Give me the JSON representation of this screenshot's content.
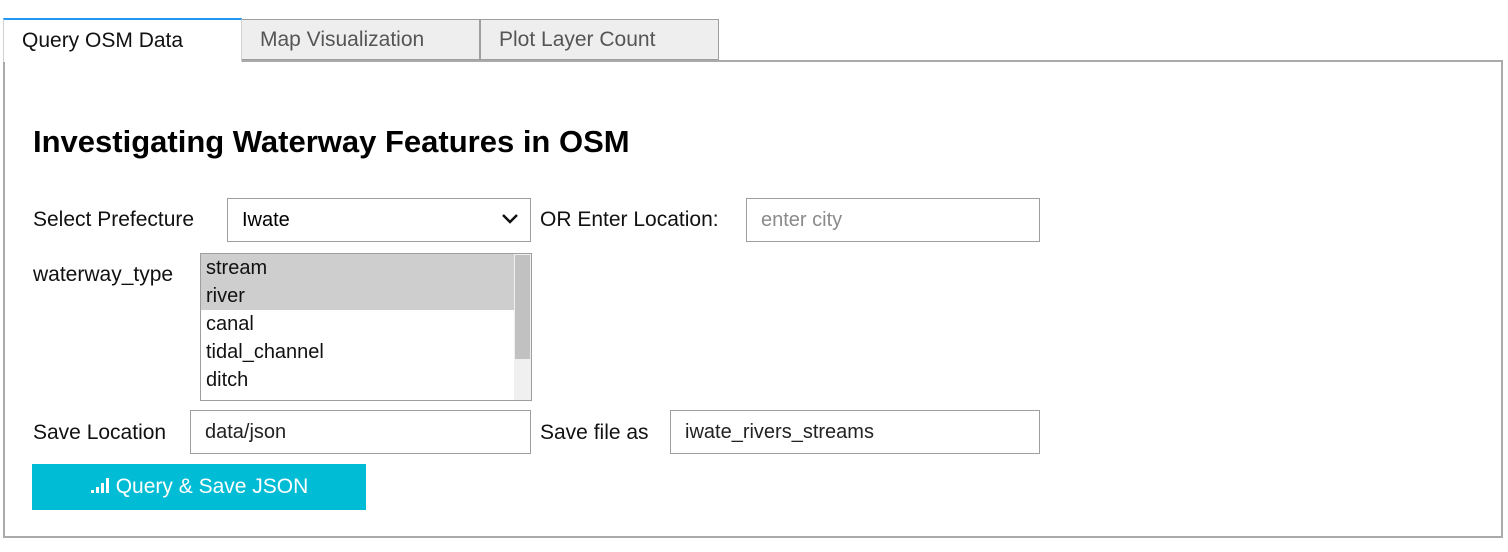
{
  "tabs": [
    {
      "label": "Query OSM Data"
    },
    {
      "label": "Map Visualization"
    },
    {
      "label": "Plot Layer Count"
    }
  ],
  "title": "Investigating Waterway Features in OSM",
  "prefecture": {
    "label": "Select Prefecture",
    "value": "Iwate"
  },
  "location": {
    "label": "OR Enter Location:",
    "placeholder": "enter city",
    "value": ""
  },
  "waterway": {
    "label": "waterway_type",
    "options": [
      "stream",
      "river",
      "canal",
      "tidal_channel",
      "ditch"
    ],
    "selected": [
      "stream",
      "river"
    ]
  },
  "save": {
    "location_label": "Save Location",
    "location_value": "data/json",
    "file_label": "Save file as",
    "file_value": "iwate_rivers_streams"
  },
  "button": {
    "label": "Query & Save JSON",
    "icon": "signal-bars-icon"
  },
  "colors": {
    "accent": "#2196f3",
    "button": "#00bcd4",
    "selected_option": "#cecece"
  }
}
